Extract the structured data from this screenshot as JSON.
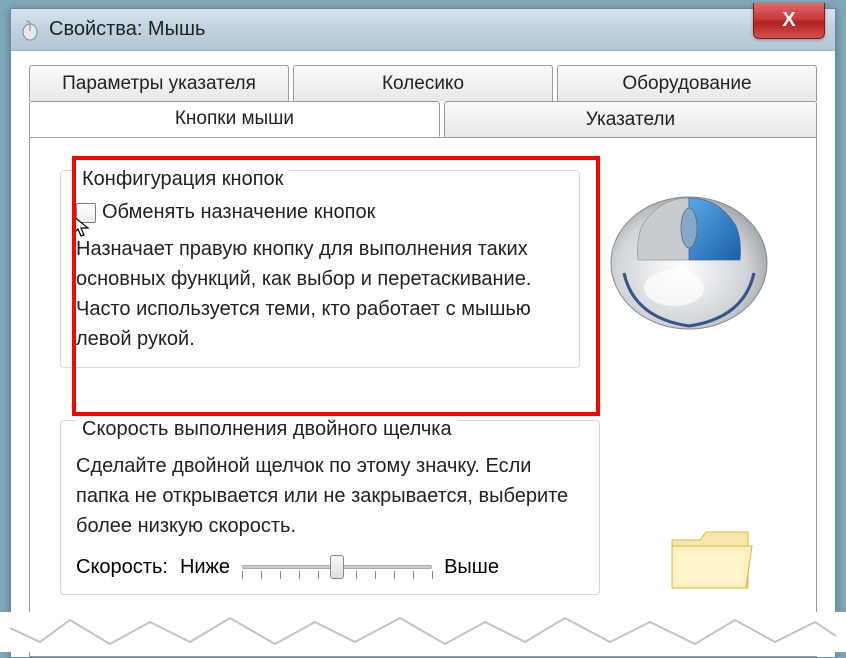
{
  "window": {
    "title": "Свойства: Мышь",
    "close_glyph": "X"
  },
  "tabs": {
    "row1": [
      "Параметры указателя",
      "Колесико",
      "Оборудование"
    ],
    "row2": [
      "Кнопки мыши",
      "Указатели"
    ],
    "active": "Кнопки мыши"
  },
  "button_config": {
    "legend": "Конфигурация кнопок",
    "checkbox_label": "Обменять назначение кнопок",
    "checkbox_checked": false,
    "description": "Назначает правую кнопку для выполнения таких основных функций, как выбор и перетаскивание. Часто используется теми, кто работает с мышью левой рукой."
  },
  "double_click": {
    "legend": "Скорость выполнения двойного щелчка",
    "description": "Сделайте двойной щелчок по этому значку. Если папка не открывается или не закрывается, выберите более низкую скорость.",
    "speed_label": "Скорость:",
    "low_label": "Ниже",
    "high_label": "Выше"
  }
}
